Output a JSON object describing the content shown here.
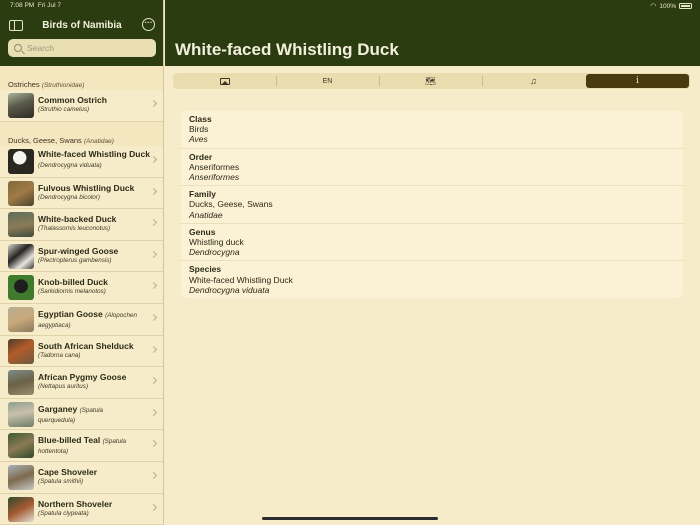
{
  "status": {
    "time": "7:08 PM",
    "date": "Fri Jul 7",
    "battery": "100%"
  },
  "sidebar": {
    "title": "Birds of Namibia",
    "search_placeholder": "Search",
    "sections": [
      {
        "name": "Ostriches",
        "latin": "(Struthionidae)"
      },
      {
        "name": "Ducks, Geese, Swans",
        "latin": "(Anatidae)"
      }
    ],
    "ostrich_item": {
      "name": "Common Ostrich",
      "latin": "(Struthio camelus)"
    },
    "items": [
      {
        "name": "White-faced Whistling Duck",
        "latin": "(Dendrocygna viduata)"
      },
      {
        "name": "Fulvous Whistling Duck",
        "latin": "(Dendrocygna bicolor)"
      },
      {
        "name": "White-backed Duck",
        "latin": "(Thalassornis leuconotus)"
      },
      {
        "name": "Spur-winged Goose",
        "latin": "(Plectropterus gambensis)"
      },
      {
        "name": "Knob-billed Duck",
        "latin": "(Sarkidiornis melanotos)"
      },
      {
        "name": "Egyptian Goose",
        "latin_inline": "(Alopochen",
        "latin": "aegyptiaca)"
      },
      {
        "name": "South African Shelduck",
        "latin": "(Tadorna cana)"
      },
      {
        "name": "African Pygmy Goose",
        "latin": "(Nettapus auritus)"
      },
      {
        "name": "Garganey",
        "latin_inline": "(Spatula",
        "latin": "querquedula)"
      },
      {
        "name": "Blue-billed Teal",
        "latin_inline": "(Spatula",
        "latin": "hottentota)"
      },
      {
        "name": "Cape Shoveler",
        "latin": "(Spatula smithii)"
      },
      {
        "name": "Northern Shoveler",
        "latin": "(Spatula clypeata)"
      }
    ]
  },
  "main": {
    "title": "White-faced Whistling Duck",
    "tabs": {
      "language": "EN"
    },
    "taxonomy": [
      {
        "label": "Class",
        "common": "Birds",
        "latin": "Aves"
      },
      {
        "label": "Order",
        "common": "Anseriformes",
        "latin": "Anseriformes"
      },
      {
        "label": "Family",
        "common": "Ducks, Geese, Swans",
        "latin": "Anatidae"
      },
      {
        "label": "Genus",
        "common": "Whistling duck",
        "latin": "Dendrocygna"
      },
      {
        "label": "Species",
        "common": "White-faced Whistling Duck",
        "latin": "Dendrocygna viduata"
      }
    ]
  },
  "colors": {
    "header_green": "#2b3d10",
    "background": "#f7ecc9",
    "active_tab": "#4a3a10"
  }
}
